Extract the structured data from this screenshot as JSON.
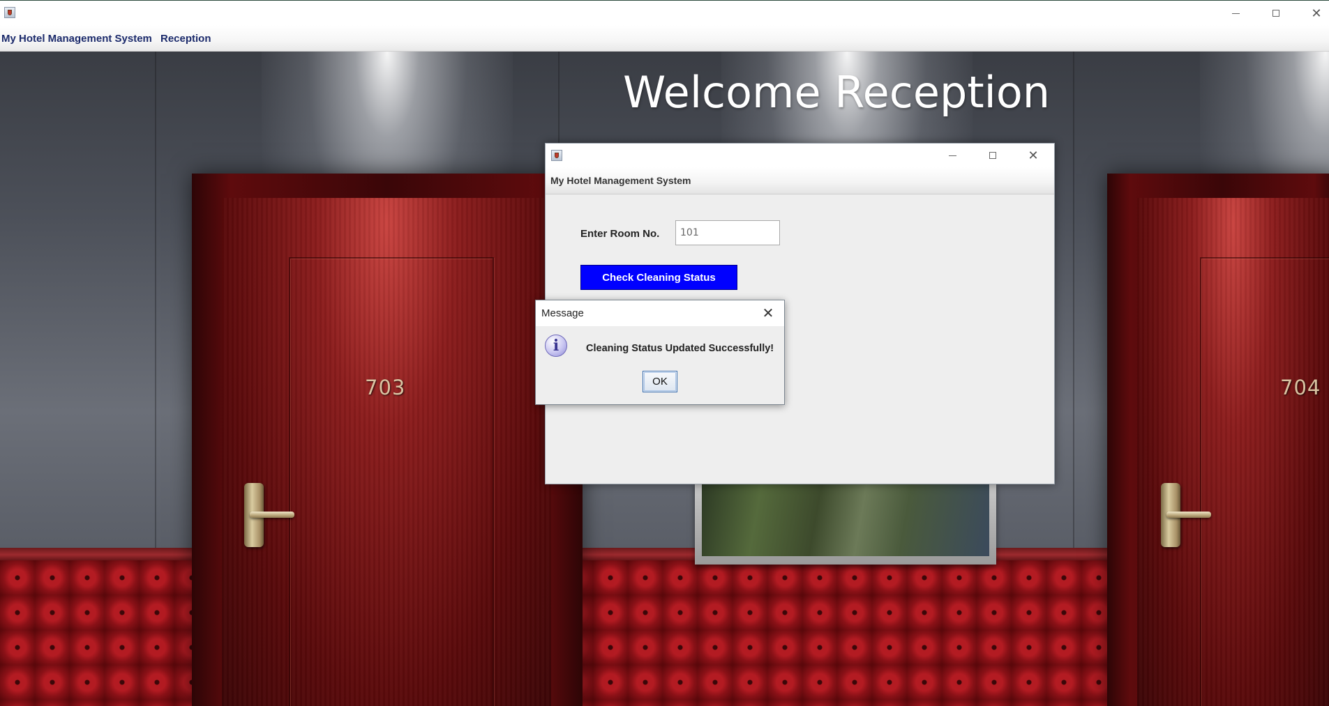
{
  "window": {
    "icon": "java-app-icon"
  },
  "menubar": {
    "items": [
      {
        "label": "My Hotel Management System"
      },
      {
        "label": "Reception"
      }
    ]
  },
  "background": {
    "heading": "Welcome Reception",
    "doors": [
      {
        "number": "703"
      },
      {
        "number": "704"
      }
    ]
  },
  "frame": {
    "title": "My Hotel Management System",
    "room_label": "Enter Room No.",
    "room_value": "101",
    "check_button": "Check Cleaning Status",
    "accent_color": "#0000ff"
  },
  "dialog": {
    "title": "Message",
    "message": "Cleaning Status Updated Successfully!",
    "ok_label": "OK",
    "icon": "info-icon"
  }
}
